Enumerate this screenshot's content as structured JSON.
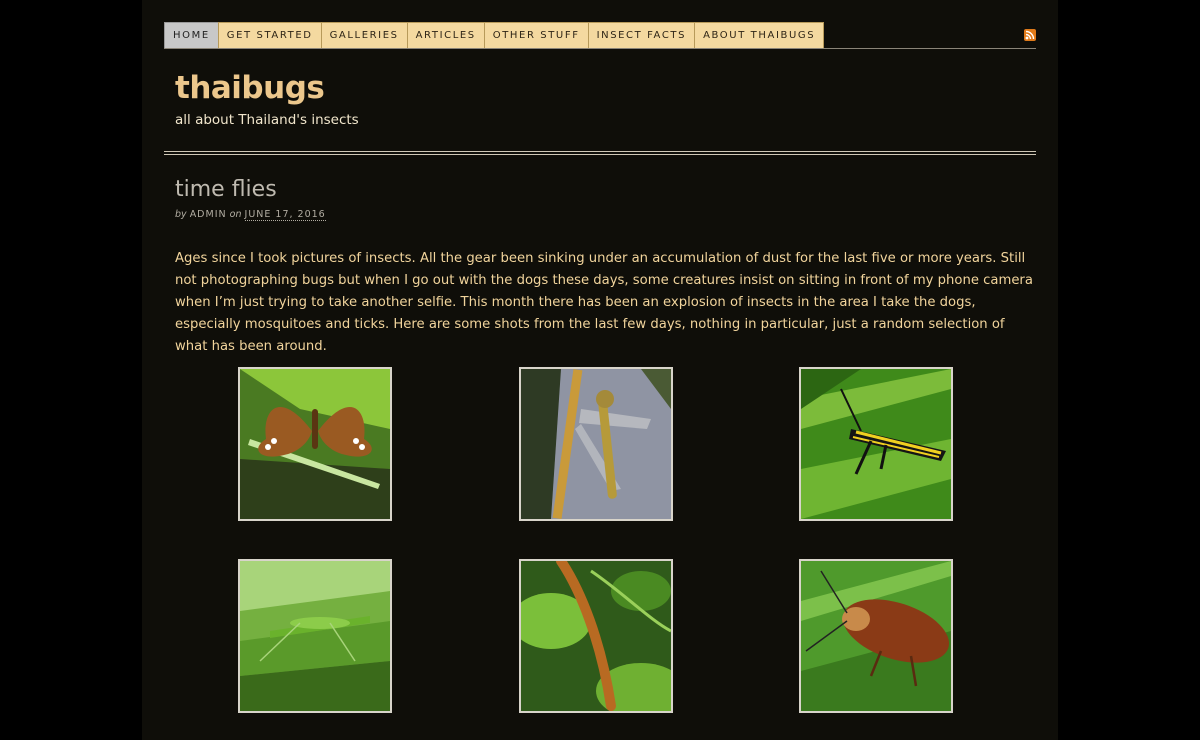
{
  "nav": {
    "items": [
      {
        "label": "HOME",
        "active": true
      },
      {
        "label": "GET STARTED",
        "active": false
      },
      {
        "label": "GALLERIES",
        "active": false
      },
      {
        "label": "ARTICLES",
        "active": false
      },
      {
        "label": "OTHER STUFF",
        "active": false
      },
      {
        "label": "INSECT FACTS",
        "active": false
      },
      {
        "label": "ABOUT THAIBUGS",
        "active": false
      }
    ],
    "rss_icon": "rss-icon"
  },
  "site": {
    "title": "thaibugs",
    "tagline": "all about Thailand's insects"
  },
  "post": {
    "title": "time flies",
    "byline_by": "by",
    "author": "ADMIN",
    "byline_on": "on",
    "date": "JUNE 17, 2016",
    "body": "Ages since I took pictures of insects. All the gear been sinking under an accumulation of dust for the last five or more years. Still not photographing bugs but when I go out with the dogs these days, some creatures insist on sitting in front of my phone camera when I’m just trying to take another selfie. This month there has been an explosion of insects in the area I take the dogs, especially mosquitoes and ticks. Here are some shots from the last few days, nothing in particular, just a random selection of what has been around."
  },
  "gallery": {
    "thumbnails": [
      {
        "subject": "butterfly"
      },
      {
        "subject": "dragonfly"
      },
      {
        "subject": "grasshopper"
      },
      {
        "subject": "katydid"
      },
      {
        "subject": "caterpillar"
      },
      {
        "subject": "cockroach"
      }
    ]
  },
  "colors": {
    "background": "#000000",
    "page": "#0f0e09",
    "nav_bg": "#f4d9a0",
    "nav_active_bg": "#c8c8c8",
    "title": "#ecc78c",
    "body_text": "#f1d49c"
  }
}
